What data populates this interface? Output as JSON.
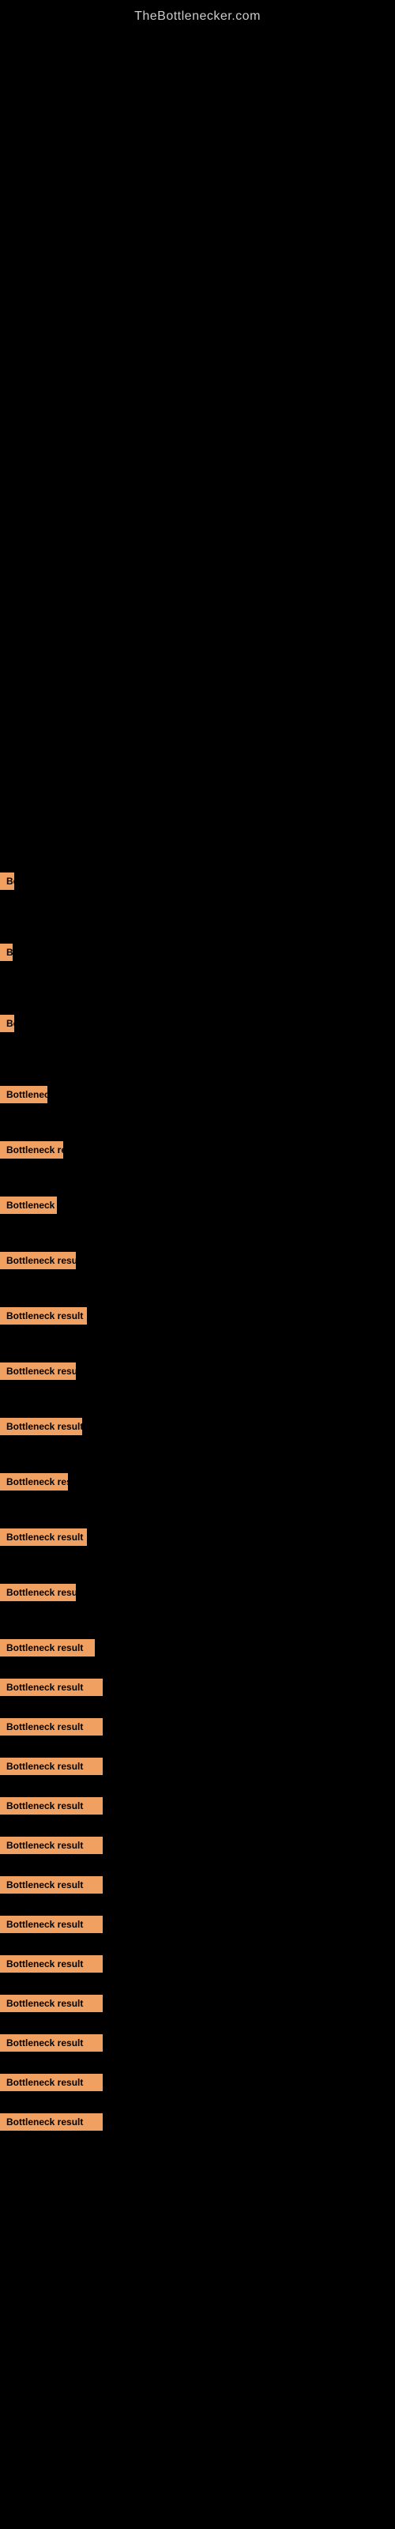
{
  "site": {
    "title": "TheBottlenecker.com"
  },
  "results": [
    {
      "id": 1,
      "label": "Bottleneck result",
      "badge_class": "badge-w1",
      "gap": "row-gap-lg"
    },
    {
      "id": 2,
      "label": "Bottleneck result",
      "badge_class": "badge-w2",
      "gap": "row-gap-lg"
    },
    {
      "id": 3,
      "label": "Bottleneck result",
      "badge_class": "badge-w3",
      "gap": "row-gap-lg"
    },
    {
      "id": 4,
      "label": "Bottleneck result",
      "badge_class": "badge-w4",
      "gap": "row-gap-md"
    },
    {
      "id": 5,
      "label": "Bottleneck result",
      "badge_class": "badge-w5",
      "gap": "row-gap-md"
    },
    {
      "id": 6,
      "label": "Bottleneck result",
      "badge_class": "badge-w6",
      "gap": "row-gap-md"
    },
    {
      "id": 7,
      "label": "Bottleneck result",
      "badge_class": "badge-w7",
      "gap": "row-gap-md"
    },
    {
      "id": 8,
      "label": "Bottleneck result",
      "badge_class": "badge-w8",
      "gap": "row-gap-md"
    },
    {
      "id": 9,
      "label": "Bottleneck result",
      "badge_class": "badge-w9",
      "gap": "row-gap-md"
    },
    {
      "id": 10,
      "label": "Bottleneck result",
      "badge_class": "badge-w10",
      "gap": "row-gap-md"
    },
    {
      "id": 11,
      "label": "Bottleneck result",
      "badge_class": "badge-w11",
      "gap": "row-gap-md"
    },
    {
      "id": 12,
      "label": "Bottleneck result",
      "badge_class": "badge-w12",
      "gap": "row-gap-md"
    },
    {
      "id": 13,
      "label": "Bottleneck result",
      "badge_class": "badge-w13",
      "gap": "row-gap-md"
    },
    {
      "id": 14,
      "label": "Bottleneck result",
      "badge_class": "badge-w14",
      "gap": "row-gap-sm"
    },
    {
      "id": 15,
      "label": "Bottleneck result",
      "badge_class": "badge-w15",
      "gap": "row-gap-sm"
    },
    {
      "id": 16,
      "label": "Bottleneck result",
      "badge_class": "badge-w16",
      "gap": "row-gap-sm"
    },
    {
      "id": 17,
      "label": "Bottleneck result",
      "badge_class": "badge-w17",
      "gap": "row-gap-sm"
    },
    {
      "id": 18,
      "label": "Bottleneck result",
      "badge_class": "badge-w18",
      "gap": "row-gap-sm"
    },
    {
      "id": 19,
      "label": "Bottleneck result",
      "badge_class": "badge-w19",
      "gap": "row-gap-sm"
    },
    {
      "id": 20,
      "label": "Bottleneck result",
      "badge_class": "badge-w20",
      "gap": "row-gap-sm"
    },
    {
      "id": 21,
      "label": "Bottleneck result",
      "badge_class": "badge-w21",
      "gap": "row-gap-sm"
    },
    {
      "id": 22,
      "label": "Bottleneck result",
      "badge_class": "badge-w22",
      "gap": "row-gap-sm"
    },
    {
      "id": 23,
      "label": "Bottleneck result",
      "badge_class": "badge-w23",
      "gap": "row-gap-sm"
    },
    {
      "id": 24,
      "label": "Bottleneck result",
      "badge_class": "badge-w24",
      "gap": "row-gap-sm"
    },
    {
      "id": 25,
      "label": "Bottleneck result",
      "badge_class": "badge-w25",
      "gap": "row-gap-sm"
    },
    {
      "id": 26,
      "label": "Bottleneck result",
      "badge_class": "badge-w26",
      "gap": ""
    }
  ]
}
